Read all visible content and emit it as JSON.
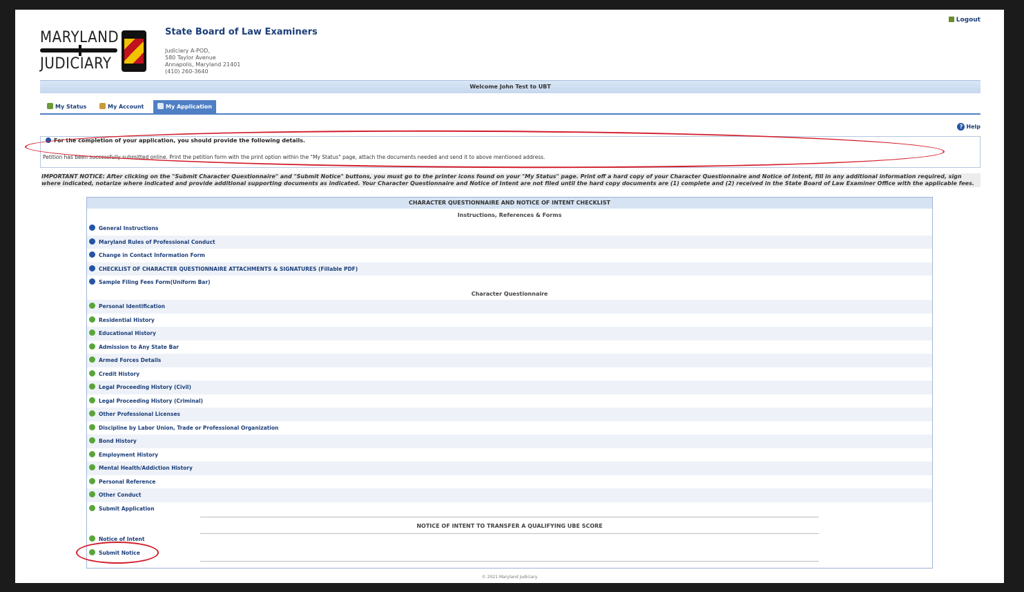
{
  "header": {
    "logo": {
      "line1": "MARYLAND",
      "line2": "JUDICIARY"
    },
    "board_title": "State Board of Law Examiners",
    "address": [
      "Judiciary A-POD,",
      "580 Taylor Avenue",
      "Annapolis, Maryland 21401",
      "(410) 260-3640"
    ],
    "logout_label": "Logout",
    "welcome": "Welcome John Test to UBT"
  },
  "tabs": [
    {
      "label": "My Status",
      "icon": "status-icon",
      "active": false
    },
    {
      "label": "My Account",
      "icon": "account-icon",
      "active": false
    },
    {
      "label": "My Application",
      "icon": "application-icon",
      "active": true
    }
  ],
  "help_label": "Help",
  "info": {
    "title": "For the completion of your application, you should provide the following details.",
    "body": "Petition has been successfully submitted online. Print the petition form with the print option within the \"My Status\" page, attach the documents needed and send it to above mentioned address."
  },
  "important_notice": "IMPORTANT NOTICE: After clicking on the \"Submit Character Questionnaire\" and \"Submit Notice\" buttons, you must go to the printer icons found on your \"My Status\" page. Print off a hard copy of your Character Questionnaire and Notice of Intent, fill in any additional information required, sign where indicated, notarize where indicated and provide additional supporting documents as indicated. Your Character Questionnaire and Notice of Intent are not filed until the hard copy documents are (1) complete and (2) received in the State Board of Law Examiner Office with the applicable fees.",
  "checklist": {
    "title": "CHARACTER QUESTIONNAIRE AND NOTICE OF INTENT CHECKLIST",
    "instructions_header": "Instructions, References & Forms",
    "instructions": [
      "General Instructions",
      "Maryland Rules of Professional Conduct",
      "Change in Contact Information Form",
      "CHECKLIST OF CHARACTER QUESTIONNAIRE ATTACHMENTS & SIGNATURES (Fillable PDF)",
      "Sample Filing Fees Form(Uniform Bar)"
    ],
    "questionnaire_header": "Character Questionnaire",
    "questionnaire": [
      "Personal Identification",
      "Residential History",
      "Educational History",
      "Admission to Any State Bar",
      "Armed Forces Details",
      "Credit History",
      "Legal Proceeding History (Civil)",
      "Legal Proceeding History (Criminal)",
      "Other Professional Licenses",
      "Discipline by Labor Union, Trade or Professional Organization",
      "Bond History",
      "Employment History",
      "Mental Health/Addiction History",
      "Personal Reference",
      "Other Conduct",
      "Submit Application"
    ],
    "notice_header": "NOTICE OF INTENT TO TRANSFER A QUALIFYING UBE SCORE",
    "notice_items": [
      "Notice of Intent",
      "Submit Notice"
    ]
  },
  "footer": "© 2021 Maryland Judiciary",
  "colors": {
    "accent": "#4f7fc4",
    "title": "#1c3f7a",
    "annotation": "#d31c2a",
    "ok": "#5aa53a"
  }
}
